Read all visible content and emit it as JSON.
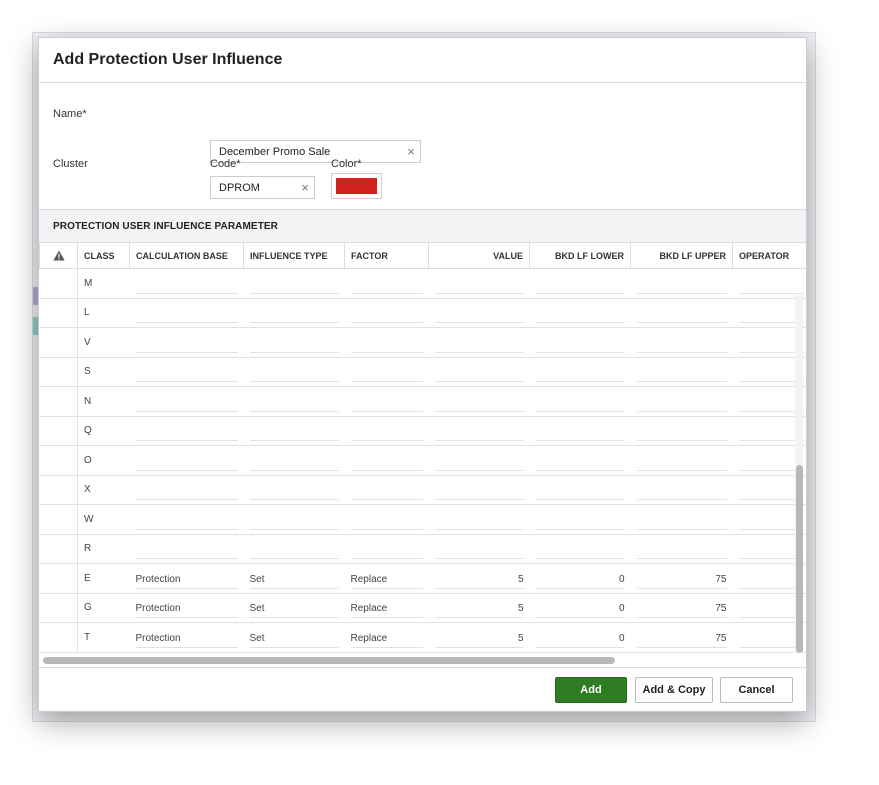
{
  "dialog": {
    "title": "Add Protection User Influence"
  },
  "form": {
    "name_label": "Name*",
    "name_value": "December Promo Sale",
    "cluster_label": "Cluster",
    "code_label": "Code*",
    "code_value": "DPROM",
    "color_label": "Color*",
    "color_value": "#d2221f",
    "clear_glyph": "×"
  },
  "section": {
    "title": "PROTECTION USER INFLUENCE PARAMETER"
  },
  "grid": {
    "warning_icon": "warning-triangle-icon",
    "columns": [
      "CLASS",
      "CALCULATION BASE",
      "INFLUENCE TYPE",
      "FACTOR",
      "VALUE",
      "BKD LF LOWER",
      "BKD LF UPPER",
      "OPERATOR"
    ],
    "rows": [
      {
        "class": "M",
        "calc_base": "",
        "influence_type": "",
        "factor": "",
        "value": "",
        "bkd_lower": "",
        "bkd_upper": "",
        "operator": ""
      },
      {
        "class": "L",
        "calc_base": "",
        "influence_type": "",
        "factor": "",
        "value": "",
        "bkd_lower": "",
        "bkd_upper": "",
        "operator": ""
      },
      {
        "class": "V",
        "calc_base": "",
        "influence_type": "",
        "factor": "",
        "value": "",
        "bkd_lower": "",
        "bkd_upper": "",
        "operator": ""
      },
      {
        "class": "S",
        "calc_base": "",
        "influence_type": "",
        "factor": "",
        "value": "",
        "bkd_lower": "",
        "bkd_upper": "",
        "operator": ""
      },
      {
        "class": "N",
        "calc_base": "",
        "influence_type": "",
        "factor": "",
        "value": "",
        "bkd_lower": "",
        "bkd_upper": "",
        "operator": ""
      },
      {
        "class": "Q",
        "calc_base": "",
        "influence_type": "",
        "factor": "",
        "value": "",
        "bkd_lower": "",
        "bkd_upper": "",
        "operator": ""
      },
      {
        "class": "O",
        "calc_base": "",
        "influence_type": "",
        "factor": "",
        "value": "",
        "bkd_lower": "",
        "bkd_upper": "",
        "operator": ""
      },
      {
        "class": "X",
        "calc_base": "",
        "influence_type": "",
        "factor": "",
        "value": "",
        "bkd_lower": "",
        "bkd_upper": "",
        "operator": ""
      },
      {
        "class": "W",
        "calc_base": "",
        "influence_type": "",
        "factor": "",
        "value": "",
        "bkd_lower": "",
        "bkd_upper": "",
        "operator": ""
      },
      {
        "class": "R",
        "calc_base": "",
        "influence_type": "",
        "factor": "",
        "value": "",
        "bkd_lower": "",
        "bkd_upper": "",
        "operator": ""
      },
      {
        "class": "E",
        "calc_base": "Protection",
        "influence_type": "Set",
        "factor": "Replace",
        "value": "5",
        "bkd_lower": "0",
        "bkd_upper": "75",
        "operator": ""
      },
      {
        "class": "G",
        "calc_base": "Protection",
        "influence_type": "Set",
        "factor": "Replace",
        "value": "5",
        "bkd_lower": "0",
        "bkd_upper": "75",
        "operator": ""
      },
      {
        "class": "T",
        "calc_base": "Protection",
        "influence_type": "Set",
        "factor": "Replace",
        "value": "5",
        "bkd_lower": "0",
        "bkd_upper": "75",
        "operator": ""
      }
    ]
  },
  "footer": {
    "add_label": "Add",
    "add_copy_label": "Add & Copy",
    "cancel_label": "Cancel"
  },
  "colors": {
    "primary_button": "#2e7d22",
    "swatch": "#d2221f"
  }
}
